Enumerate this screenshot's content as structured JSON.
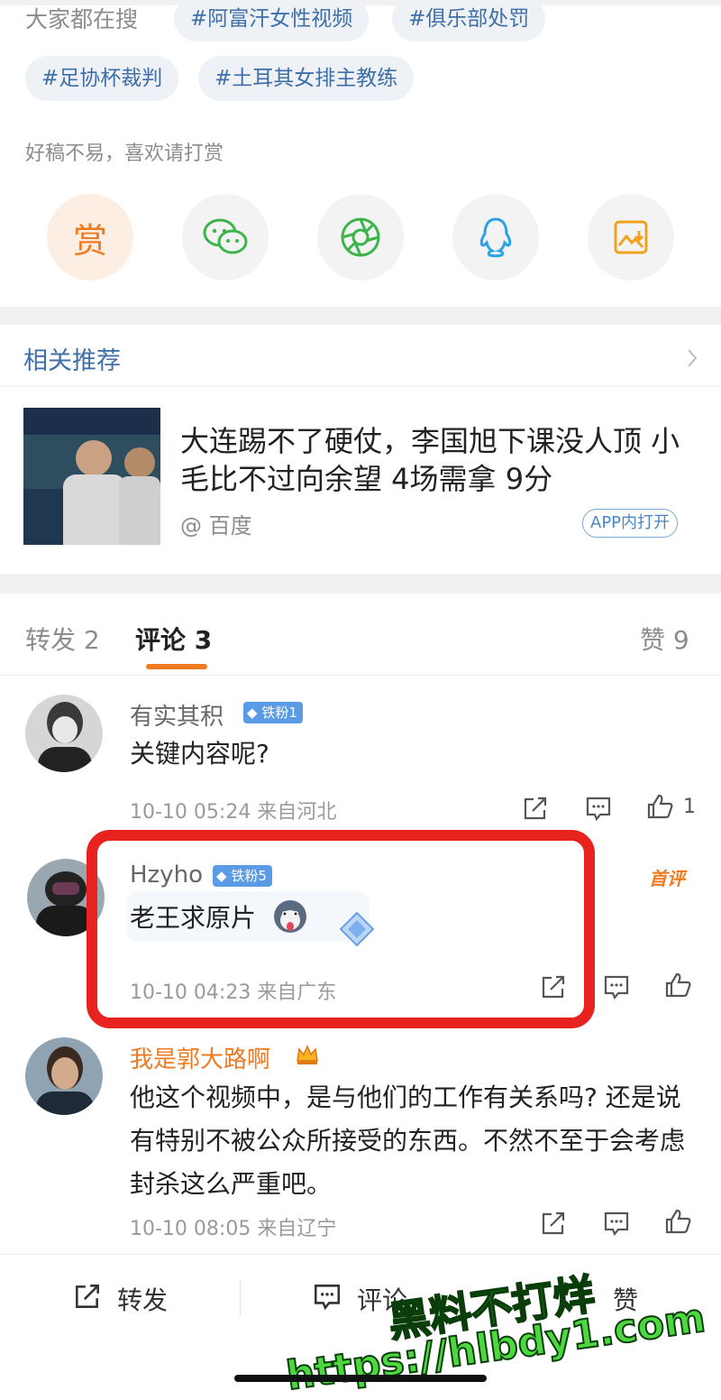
{
  "search": {
    "label": "大家都在搜",
    "chips": [
      "#阿富汗女性视频",
      "#俱乐部处罚",
      "#足协杯裁判",
      "#土耳其女排主教练"
    ]
  },
  "reward": {
    "note": "好稿不易，喜欢请打赏",
    "reward_glyph": "赏"
  },
  "related": {
    "title": "相关推荐",
    "headline": "大连踢不了硬仗，李国旭下课没人顶 小毛比不过向余望 4场需拿 9分",
    "source": "@ 百度",
    "app_badge": "APP内打开"
  },
  "tabs": {
    "repost": "转发 2",
    "comments": "评论 3",
    "likes": "赞 9"
  },
  "comments": [
    {
      "name": "有实其积",
      "badge": "铁粉1",
      "text": "关键内容呢?",
      "meta": "10-10 05:24 来自河北",
      "likes": "1"
    },
    {
      "name": "Hzyho",
      "badge": "铁粉5",
      "text": "老王求原片",
      "meta": "10-10 04:23 来自广东",
      "tag": "首评"
    },
    {
      "name": "我是郭大路啊",
      "text": "他这个视频中，是与他们的工作有关系吗? 还是说有特别不被公众所接受的东西。不然不至于会考虑封杀这么严重吧。",
      "meta": "10-10 08:05 来自辽宁"
    }
  ],
  "bottom": {
    "repost": "转发",
    "comment": "评论",
    "like": "赞"
  },
  "watermark": {
    "line1": "黑料不打烊",
    "line2": "https://hlbdy1.com"
  },
  "colors": {
    "link_blue": "#3e6fa8",
    "accent_orange": "#f07a22",
    "highlight_red": "#e8221f"
  }
}
